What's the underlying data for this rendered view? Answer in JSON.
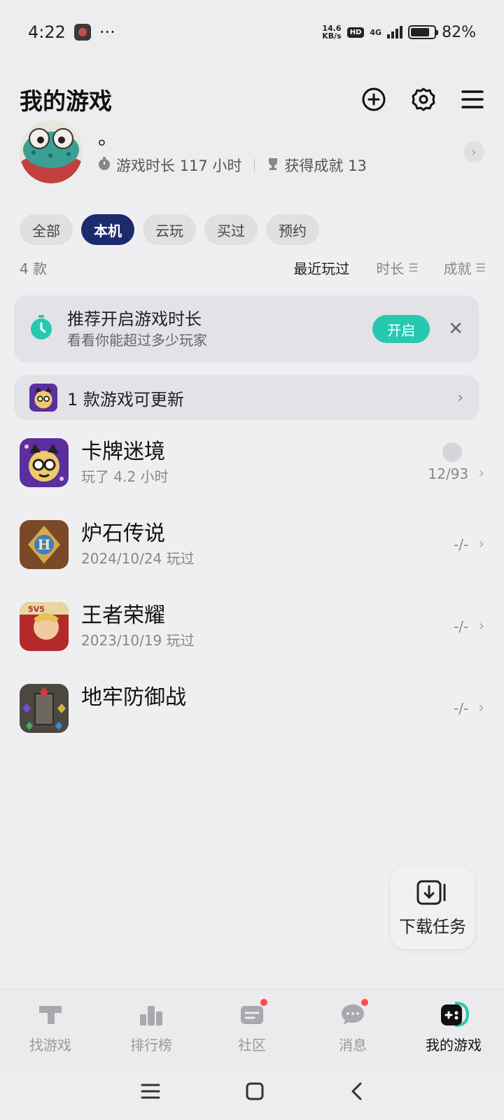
{
  "status_bar": {
    "time": "4:22",
    "dots": "···",
    "net_speed_value": "14.6",
    "net_speed_unit": "KB/s",
    "hd": "HD",
    "network": "4G",
    "battery": "82%",
    "battery_level": 0.82
  },
  "header": {
    "title": "我的游戏",
    "icons": [
      "add-circle-icon",
      "gear-icon",
      "menu-icon"
    ]
  },
  "profile": {
    "nickname": "。",
    "playtime_label": "游戏时长 117 小时",
    "achievement_label": "获得成就 13"
  },
  "filters": {
    "tabs": [
      "全部",
      "本机",
      "云玩",
      "买过",
      "预约"
    ],
    "active_index": 1
  },
  "sort": {
    "count": "4 款",
    "options": [
      "最近玩过",
      "时长",
      "成就"
    ],
    "active_index": 0
  },
  "banner": {
    "title": "推荐开启游戏时长",
    "subtitle": "看看你能超过多少玩家",
    "button": "开启"
  },
  "update_row": {
    "text": "1 款游戏可更新"
  },
  "games": [
    {
      "name": "卡牌迷境",
      "subtitle": "玩了 4.2 小时",
      "right": "12/93",
      "icon": "card-game-cat-icon",
      "has_badge": true
    },
    {
      "name": "炉石传说",
      "subtitle": "2024/10/24 玩过",
      "right": "-/-",
      "icon": "hearthstone-icon",
      "has_badge": false
    },
    {
      "name": "王者荣耀",
      "subtitle": "2023/10/19 玩过",
      "right": "-/-",
      "icon": "honor-of-kings-icon",
      "has_badge": false
    },
    {
      "name": "地牢防御战",
      "subtitle": "",
      "right": "-/-",
      "icon": "dungeon-defense-icon",
      "has_badge": false
    }
  ],
  "download_fab": {
    "label": "下载任务"
  },
  "bottom_nav": {
    "items": [
      "找游戏",
      "排行榜",
      "社区",
      "消息",
      "我的游戏"
    ],
    "active_index": 4
  },
  "colors": {
    "accent_dark": "#1e2a6e",
    "accent_teal": "#27c8b0",
    "badge_red": "#ff4a4a"
  }
}
